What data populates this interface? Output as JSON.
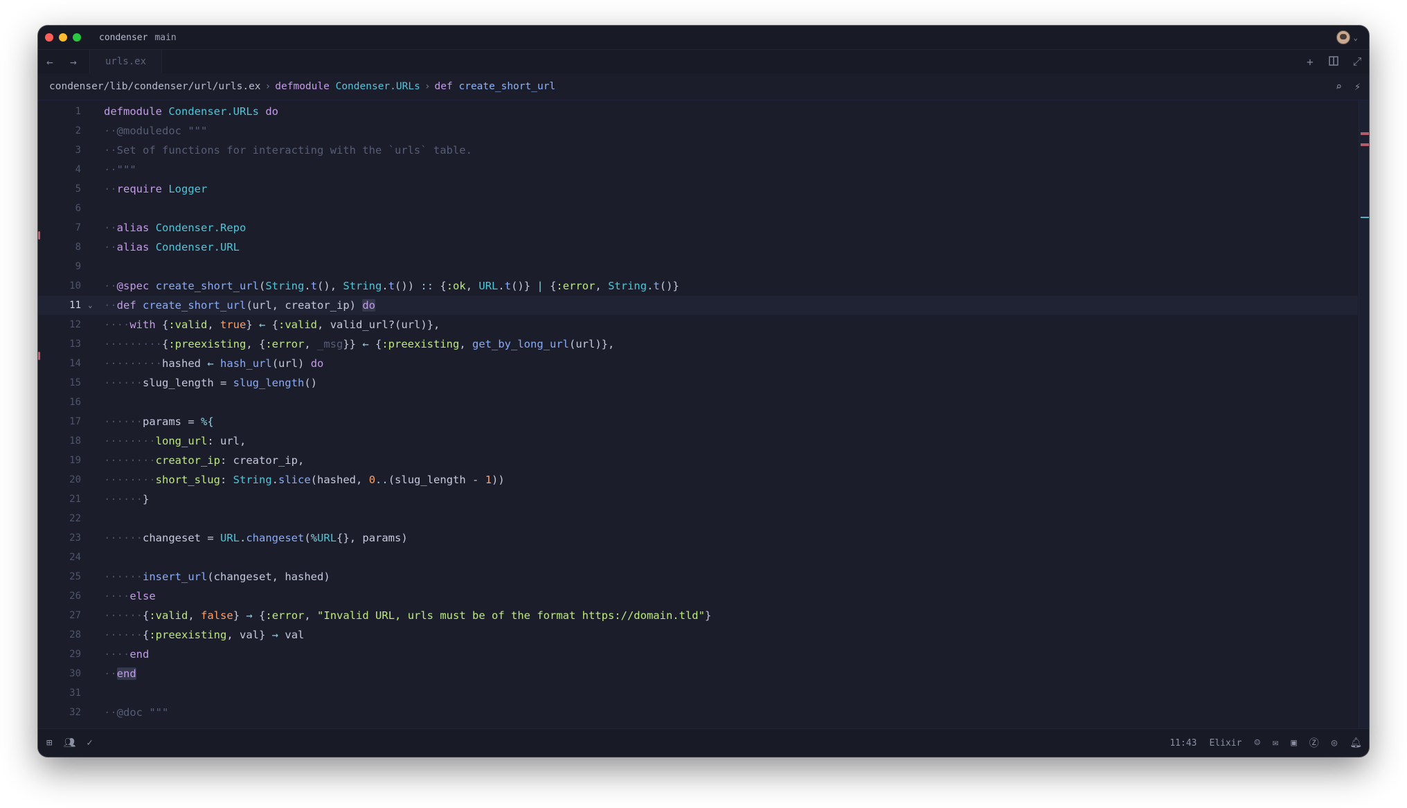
{
  "window": {
    "project": "condenser",
    "branch": "main"
  },
  "tab": {
    "label": "urls.ex"
  },
  "breadcrumb": {
    "path": "condenser/lib/condenser/url/urls.ex",
    "module_kw": "defmodule",
    "module_name": "Condenser.URLs",
    "def_kw": "def",
    "fn_name": "create_short_url"
  },
  "editor": {
    "language": "Elixir",
    "cursor": "11:43",
    "active_line": 11
  },
  "lines": [
    {
      "n": "1",
      "code": "defmodule Condenser.URLs do"
    },
    {
      "n": "2",
      "code": "  @moduledoc \"\"\""
    },
    {
      "n": "3",
      "code": "  Set of functions for interacting with the `urls` table."
    },
    {
      "n": "4",
      "code": "  \"\"\""
    },
    {
      "n": "5",
      "code": "  require Logger"
    },
    {
      "n": "6",
      "code": ""
    },
    {
      "n": "7",
      "code": "  alias Condenser.Repo"
    },
    {
      "n": "8",
      "code": "  alias Condenser.URL"
    },
    {
      "n": "9",
      "code": ""
    },
    {
      "n": "10",
      "code": "  @spec create_short_url(String.t(), String.t()) :: {:ok, URL.t()} | {:error, String.t()}"
    },
    {
      "n": "11",
      "code": "  def create_short_url(url, creator_ip) do"
    },
    {
      "n": "12",
      "code": "    with {:valid, true} <- {:valid, valid_url?(url)},"
    },
    {
      "n": "13",
      "code": "         {:preexisting, {:error, _msg}} <- {:preexisting, get_by_long_url(url)},"
    },
    {
      "n": "14",
      "code": "         hashed <- hash_url(url) do"
    },
    {
      "n": "15",
      "code": "      slug_length = slug_length()"
    },
    {
      "n": "16",
      "code": ""
    },
    {
      "n": "17",
      "code": "      params = %{"
    },
    {
      "n": "18",
      "code": "        long_url: url,"
    },
    {
      "n": "19",
      "code": "        creator_ip: creator_ip,"
    },
    {
      "n": "20",
      "code": "        short_slug: String.slice(hashed, 0..(slug_length - 1))"
    },
    {
      "n": "21",
      "code": "      }"
    },
    {
      "n": "22",
      "code": ""
    },
    {
      "n": "23",
      "code": "      changeset = URL.changeset(%URL{}, params)"
    },
    {
      "n": "24",
      "code": ""
    },
    {
      "n": "25",
      "code": "      insert_url(changeset, hashed)"
    },
    {
      "n": "26",
      "code": "    else"
    },
    {
      "n": "27",
      "code": "      {:valid, false} -> {:error, \"Invalid URL, urls must be of the format https://domain.tld\"}"
    },
    {
      "n": "28",
      "code": "      {:preexisting, val} -> val"
    },
    {
      "n": "29",
      "code": "    end"
    },
    {
      "n": "30",
      "code": "  end"
    },
    {
      "n": "31",
      "code": ""
    },
    {
      "n": "32",
      "code": "  @doc \"\"\""
    }
  ],
  "colors": {
    "background": "#1b1d2a",
    "keyword": "#c49be8",
    "module": "#4ec6d8",
    "function": "#8aabf5",
    "atom": "#bde87d",
    "number": "#ff9e64",
    "comment": "#565d76",
    "git_marker": "#c65a6a"
  },
  "icons": {
    "titlebar": [
      "avatar",
      "chevron-down-icon"
    ],
    "tabbar": [
      "arrow-left-icon",
      "arrow-right-icon",
      "plus-icon",
      "split-pane-icon",
      "maximize-icon"
    ],
    "breadcrumb": [
      "search-icon",
      "magic-wand-icon"
    ],
    "status_left": [
      "project-tree-icon",
      "collaborators-icon",
      "diagnostics-check-icon"
    ],
    "status_right": [
      "copilot-icon",
      "mail-icon",
      "terminal-icon",
      "zed-icon",
      "assistant-icon",
      "bell-icon"
    ]
  }
}
